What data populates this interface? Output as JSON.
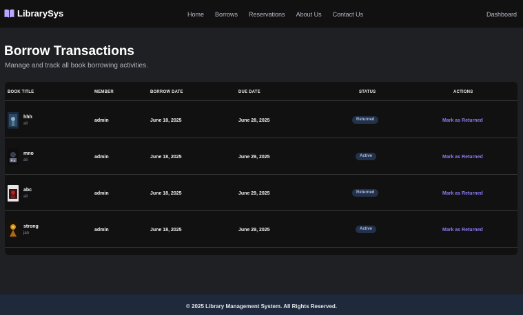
{
  "nav": {
    "brand": "LibrarySys",
    "links": [
      "Home",
      "Borrows",
      "Reservations",
      "About Us",
      "Contact Us"
    ],
    "dashboard": "Dashboard"
  },
  "header": {
    "title": "Borrow Transactions",
    "subtitle": "Manage and track all book borrowing activities."
  },
  "table": {
    "columns": [
      "BOOK TITLE",
      "MEMBER",
      "BORROW DATE",
      "DUE DATE",
      "STATUS",
      "ACTIONS"
    ],
    "rows": [
      {
        "title": "hhh",
        "author": "ali",
        "member": "admin",
        "borrow_date": "June 18, 2025",
        "due_date": "June 28, 2025",
        "status": "Returned",
        "action": "Mark as Returned"
      },
      {
        "title": "mno",
        "author": "ali",
        "member": "admin",
        "borrow_date": "June 18, 2025",
        "due_date": "June 29, 2025",
        "status": "Active",
        "action": "Mark as Returned"
      },
      {
        "title": "abc",
        "author": "ali",
        "member": "admin",
        "borrow_date": "June 18, 2025",
        "due_date": "June 29, 2025",
        "status": "Returned",
        "action": "Mark as Returned"
      },
      {
        "title": "strong",
        "author": "jan",
        "member": "admin",
        "borrow_date": "June 18, 2025",
        "due_date": "June 29, 2025",
        "status": "Active",
        "action": "Mark as Returned"
      }
    ]
  },
  "footer": {
    "text": "© 2025 Library Management System. All Rights Reserved."
  },
  "colors": {
    "accent": "#8b7cf6",
    "badge_bg": "#23314a",
    "footer_bg": "#1e293b"
  }
}
